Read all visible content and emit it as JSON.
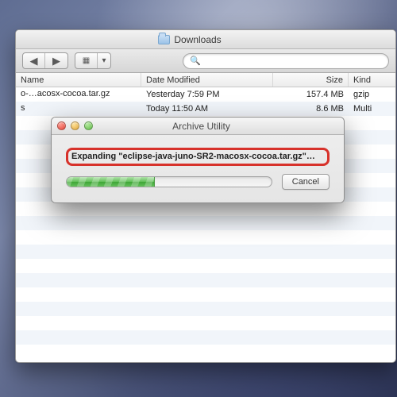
{
  "finder": {
    "title": "Downloads",
    "columns": {
      "name": "Name",
      "date": "Date Modified",
      "size": "Size",
      "kind": "Kind"
    },
    "rows": [
      {
        "name": "o-…acosx-cocoa.tar.gz",
        "date": "Yesterday 7:59 PM",
        "size": "157.4 MB",
        "kind": "gzip"
      },
      {
        "name": "s",
        "date": "Today 11:50 AM",
        "size": "8.6 MB",
        "kind": "Multi"
      }
    ]
  },
  "dialog": {
    "title": "Archive Utility",
    "status_label": "Expanding \"eclipse-java-juno-SR2-macosx-cocoa.tar.gz\"…",
    "cancel_label": "Cancel",
    "progress_percent": 43
  },
  "icons": {
    "chevron_left": "◀",
    "chevron_right": "▶",
    "view_grid": "▦",
    "dropdown": "▾",
    "magnifier": "🔍"
  }
}
